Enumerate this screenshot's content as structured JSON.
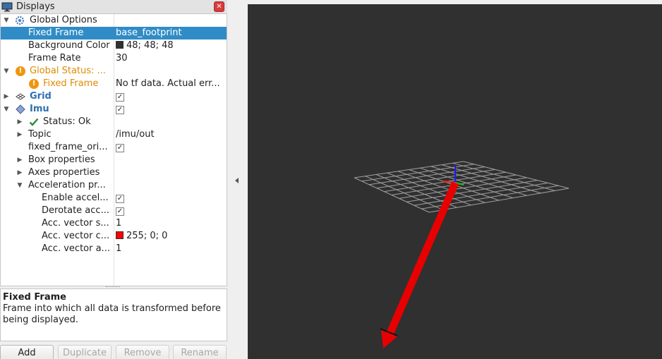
{
  "panel": {
    "title": "Displays",
    "description": {
      "title": "Fixed Frame",
      "text": "Frame into which all data is transformed before being displayed."
    }
  },
  "tree": {
    "global_options": {
      "label": "Global Options"
    },
    "fixed_frame": {
      "label": "Fixed Frame",
      "value": "base_footprint"
    },
    "background_color": {
      "label": "Background Color",
      "value": "48; 48; 48",
      "color": "#303030"
    },
    "frame_rate": {
      "label": "Frame Rate",
      "value": "30"
    },
    "global_status": {
      "label": "Global Status: ..."
    },
    "status_fixed_frame": {
      "label": "Fixed Frame",
      "value": "No tf data.  Actual err..."
    },
    "grid": {
      "label": "Grid",
      "checked": true
    },
    "imu": {
      "label": "Imu",
      "checked": true
    },
    "imu_status": {
      "label": "Status: Ok"
    },
    "topic": {
      "label": "Topic",
      "value": "/imu/out"
    },
    "fixed_frame_ori": {
      "label": "fixed_frame_ori...",
      "checked": true
    },
    "box_properties": {
      "label": "Box properties"
    },
    "axes_properties": {
      "label": "Axes properties"
    },
    "acceleration": {
      "label": "Acceleration pr..."
    },
    "enable_accel": {
      "label": "Enable accel...",
      "checked": true
    },
    "derotate_acc": {
      "label": "Derotate acc...",
      "checked": true
    },
    "acc_vector_s": {
      "label": "Acc. vector s...",
      "value": "1"
    },
    "acc_vector_c": {
      "label": "Acc. vector c...",
      "value": "255; 0; 0",
      "color": "#ff0000"
    },
    "acc_vector_a": {
      "label": "Acc. vector a...",
      "value": "1"
    }
  },
  "buttons": {
    "add": "Add",
    "duplicate": "Duplicate",
    "remove": "Remove",
    "rename": "Rename"
  },
  "colors": {
    "selection": "#308cc6",
    "status_warn": "#e08a00",
    "display_blue": "#2f6fb2",
    "viewport_bg": "#303030",
    "acc_arrow": "#ff0000"
  }
}
